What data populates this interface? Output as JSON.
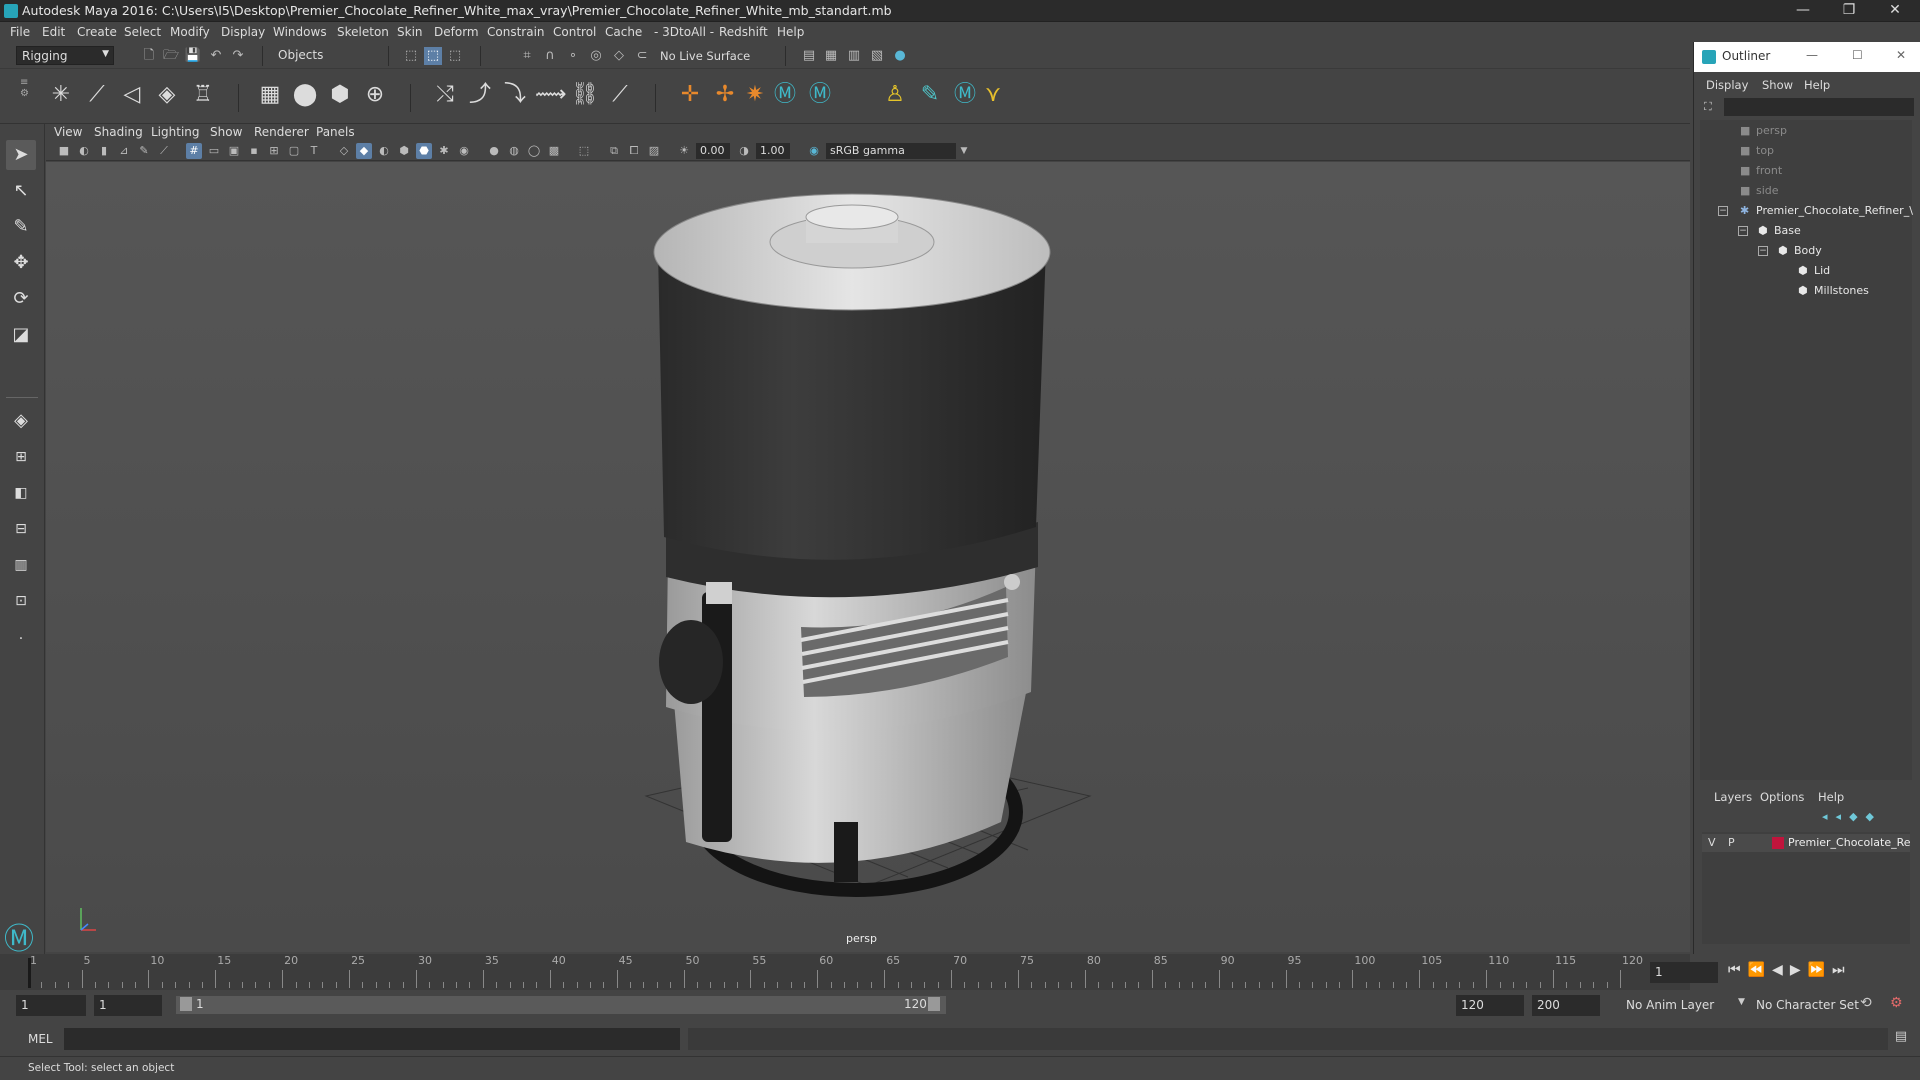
{
  "window": {
    "title": "Autodesk Maya 2016: C:\\Users\\I5\\Desktop\\Premier_Chocolate_Refiner_White_max_vray\\Premier_Chocolate_Refiner_White_mb_standart.mb",
    "minimize": "—",
    "restore": "❐",
    "close": "✕"
  },
  "menu": [
    "File",
    "Edit",
    "Create",
    "Select",
    "Modify",
    "Display",
    "Windows",
    "Skeleton",
    "Skin",
    "Deform",
    "Constrain",
    "Control",
    "Cache",
    "- 3DtoAll -",
    "Redshift",
    "Help"
  ],
  "status_line": {
    "menu_set": "Rigging",
    "selection_mode": "Objects",
    "live_surface": "No Live Surface"
  },
  "viewport": {
    "menu": [
      "View",
      "Shading",
      "Lighting",
      "Show",
      "Renderer",
      "Panels"
    ],
    "exposure": "0.00",
    "gamma": "1.00",
    "color_space": "sRGB gamma",
    "camera_label": "persp"
  },
  "timeline": {
    "ticks": [
      "1",
      "5",
      "10",
      "15",
      "20",
      "25",
      "30",
      "35",
      "40",
      "45",
      "50",
      "55",
      "60",
      "65",
      "70",
      "75",
      "80",
      "85",
      "90",
      "95",
      "100",
      "105",
      "110",
      "115",
      "120"
    ],
    "current_frame": "1"
  },
  "range": {
    "start": "1",
    "playback_start": "1",
    "slider_start": "1",
    "slider_end": "120",
    "playback_end": "120",
    "end": "200",
    "anim_layer": "No Anim Layer",
    "character_set": "No Character Set"
  },
  "command": {
    "language": "MEL"
  },
  "help_line": "Select Tool: select an object",
  "outliner": {
    "title": "Outliner",
    "menu": [
      "Display",
      "Show",
      "Help"
    ],
    "items": [
      {
        "label": "persp",
        "dim": true
      },
      {
        "label": "top",
        "dim": true
      },
      {
        "label": "front",
        "dim": true
      },
      {
        "label": "side",
        "dim": true
      },
      {
        "label": "Premier_Chocolate_Refiner_\\",
        "dim": false
      },
      {
        "label": "Base",
        "dim": false
      },
      {
        "label": "Body",
        "dim": false
      },
      {
        "label": "Lid",
        "dim": false
      },
      {
        "label": "Millstones",
        "dim": false
      }
    ]
  },
  "layers": {
    "menu": [
      "Layers",
      "Options",
      "Help"
    ],
    "layer": {
      "v": "V",
      "p": "P",
      "name": "Premier_Chocolate_Re",
      "color": "#c0143c"
    }
  }
}
